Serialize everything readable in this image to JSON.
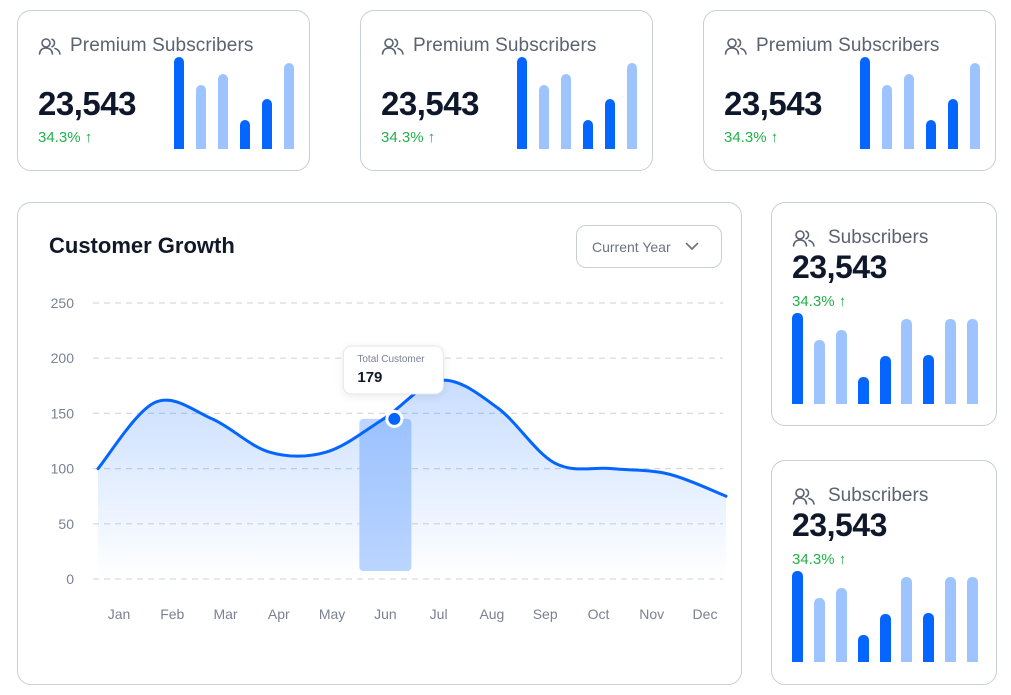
{
  "stat_cards": [
    {
      "label": "Premium Subscribers",
      "value": "23,543",
      "change": "34.3%",
      "arrow": "↑",
      "bars": [
        {
          "level": 1.0,
          "dark": true
        },
        {
          "level": 0.7,
          "dark": false
        },
        {
          "level": 0.81,
          "dark": false
        },
        {
          "level": 0.31,
          "dark": true
        },
        {
          "level": 0.54,
          "dark": true
        },
        {
          "level": 0.93,
          "dark": false
        }
      ]
    },
    {
      "label": "Premium Subscribers",
      "value": "23,543",
      "change": "34.3%",
      "arrow": "↑",
      "bars": [
        {
          "level": 1.0,
          "dark": true
        },
        {
          "level": 0.7,
          "dark": false
        },
        {
          "level": 0.81,
          "dark": false
        },
        {
          "level": 0.31,
          "dark": true
        },
        {
          "level": 0.54,
          "dark": true
        },
        {
          "level": 0.93,
          "dark": false
        }
      ]
    },
    {
      "label": "Premium Subscribers",
      "value": "23,543",
      "change": "34.3%",
      "arrow": "↑",
      "bars": [
        {
          "level": 1.0,
          "dark": true
        },
        {
          "level": 0.7,
          "dark": false
        },
        {
          "level": 0.81,
          "dark": false
        },
        {
          "level": 0.31,
          "dark": true
        },
        {
          "level": 0.54,
          "dark": true
        },
        {
          "level": 0.93,
          "dark": false
        }
      ]
    }
  ],
  "side_cards": [
    {
      "label": "Subscribers",
      "value": "23,543",
      "change": "34.3%",
      "arrow": "↑",
      "bars": [
        {
          "level": 1.0,
          "dark": true
        },
        {
          "level": 0.7,
          "dark": false
        },
        {
          "level": 0.81,
          "dark": false
        },
        {
          "level": 0.3,
          "dark": true
        },
        {
          "level": 0.53,
          "dark": true
        },
        {
          "level": 0.93,
          "dark": false
        },
        {
          "level": 0.54,
          "dark": true
        },
        {
          "level": 0.93,
          "dark": false
        },
        {
          "level": 0.93,
          "dark": false
        }
      ]
    },
    {
      "label": "Subscribers",
      "value": "23,543",
      "change": "34.3%",
      "arrow": "↑",
      "bars": [
        {
          "level": 1.0,
          "dark": true
        },
        {
          "level": 0.7,
          "dark": false
        },
        {
          "level": 0.81,
          "dark": false
        },
        {
          "level": 0.3,
          "dark": true
        },
        {
          "level": 0.53,
          "dark": true
        },
        {
          "level": 0.93,
          "dark": false
        },
        {
          "level": 0.54,
          "dark": true
        },
        {
          "level": 0.93,
          "dark": false
        },
        {
          "level": 0.93,
          "dark": false
        }
      ]
    }
  ],
  "growth": {
    "title": "Customer Growth",
    "period_select": {
      "value": "Current Year",
      "icon": "chevron-down-icon"
    },
    "tooltip": {
      "label": "Total Customer",
      "value": "179",
      "category": "Jun"
    }
  },
  "colors": {
    "accent": "#0565ff",
    "accent_light": "#9ec4ff",
    "positive": "#22b04b",
    "border": "#c9cdd4"
  },
  "chart_data": {
    "type": "area",
    "title": "Customer Growth",
    "categories": [
      "Jan",
      "Feb",
      "Mar",
      "Apr",
      "May",
      "Jun",
      "Jul",
      "Aug",
      "Sep",
      "Oct",
      "Nov",
      "Dec"
    ],
    "values": [
      100,
      160,
      145,
      115,
      115,
      145,
      180,
      155,
      105,
      100,
      95,
      75
    ],
    "yticks": [
      0,
      50,
      100,
      150,
      200,
      250
    ],
    "ylim": [
      0,
      250
    ],
    "grid": true,
    "highlight": {
      "category": "Jun",
      "value": 179
    }
  }
}
